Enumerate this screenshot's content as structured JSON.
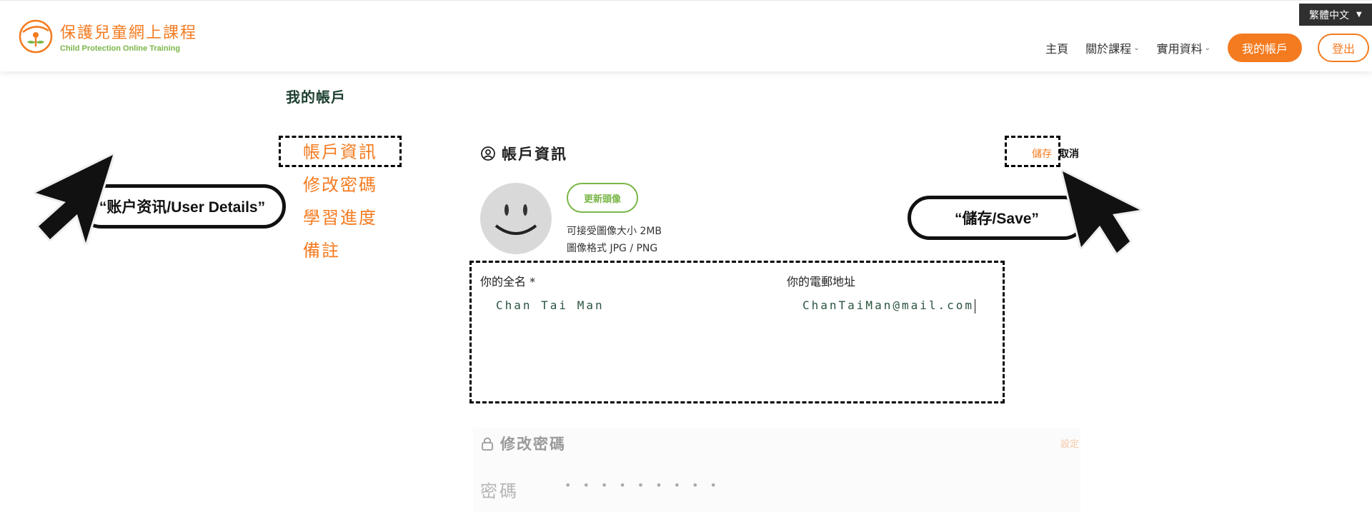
{
  "header": {
    "logo_zh": "保護兒童網上課程",
    "logo_en": "Child Protection Online Training",
    "language": "繁體中文",
    "nav": [
      "主頁",
      "關於課程",
      "實用資料"
    ],
    "account_button": "我的帳戶",
    "logout_button": "登出"
  },
  "page_title": "我的帳戶",
  "side_menu": [
    "帳戶資訊",
    "修改密碼",
    "學習進度",
    "備註"
  ],
  "account_section": {
    "title": "帳戶資訊",
    "save": "儲存",
    "cancel": "取消",
    "update_avatar": "更新頭像",
    "size_note": "可接受圖像大小 2MB",
    "format_note": "圖像格式 JPG / PNG",
    "name_label": "你的全名 *",
    "name_value": "Chan Tai Man",
    "email_label": "你的電郵地址",
    "email_value": "ChanTaiMan@mail.com"
  },
  "password_section": {
    "title": "修改密碼",
    "set": "設定",
    "label": "密碼",
    "dots": "•••••••••"
  },
  "annotations": {
    "left": "“账户资讯/User Details”",
    "right": "“儲存/Save”"
  },
  "colors": {
    "brand_orange": "#f47b20",
    "brand_green": "#7ab648",
    "title_green": "#1e4030"
  }
}
